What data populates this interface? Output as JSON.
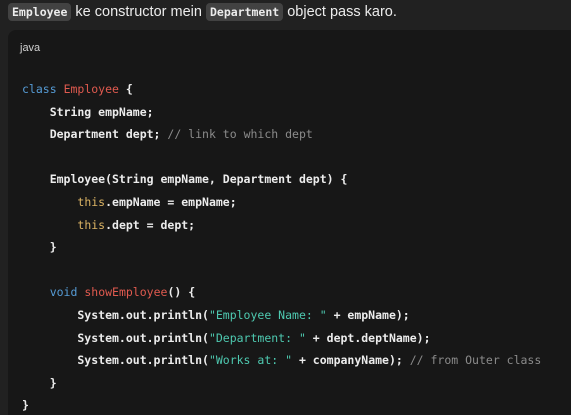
{
  "intro": {
    "code1": "Employee",
    "text1": " ke constructor mein ",
    "code2": "Department",
    "text2": " object pass karo."
  },
  "code_block": {
    "language": "java",
    "tokens": {
      "t_class": "class",
      "t_emp_cls": "Employee",
      "t_l1_rest": " {",
      "t_l2": "    String empName;",
      "t_l3a": "    Department dept; ",
      "t_l3c": "// link to which dept",
      "t_l5": "    Employee(String empName, Department dept) {",
      "t_l6ind": "        ",
      "t_this1": "this",
      "t_l6rest": ".empName = empName;",
      "t_l7ind": "        ",
      "t_this2": "this",
      "t_l7rest": ".dept = dept;",
      "t_l8": "    }",
      "t_l10ind": "    ",
      "t_void": "void",
      "t_sp": " ",
      "t_show": "showEmployee",
      "t_l10rest": "() {",
      "t_l11a": "        System.out.println(",
      "t_l11s": "\"Employee Name: \"",
      "t_l11b": " + empName);",
      "t_l12a": "        System.out.println(",
      "t_l12s": "\"Department: \"",
      "t_l12b": " + dept.deptName);",
      "t_l13a": "        System.out.println(",
      "t_l13s": "\"Works at: \"",
      "t_l13b": " + companyName); ",
      "t_l13c": "// from Outer class",
      "t_l14": "    }",
      "t_l15": "}"
    }
  },
  "colors": {
    "keyword": "#569cd6",
    "class_name": "#e05a4f",
    "comment": "#8b8b8b",
    "this": "#dcb464",
    "string": "#4ec9b0"
  }
}
